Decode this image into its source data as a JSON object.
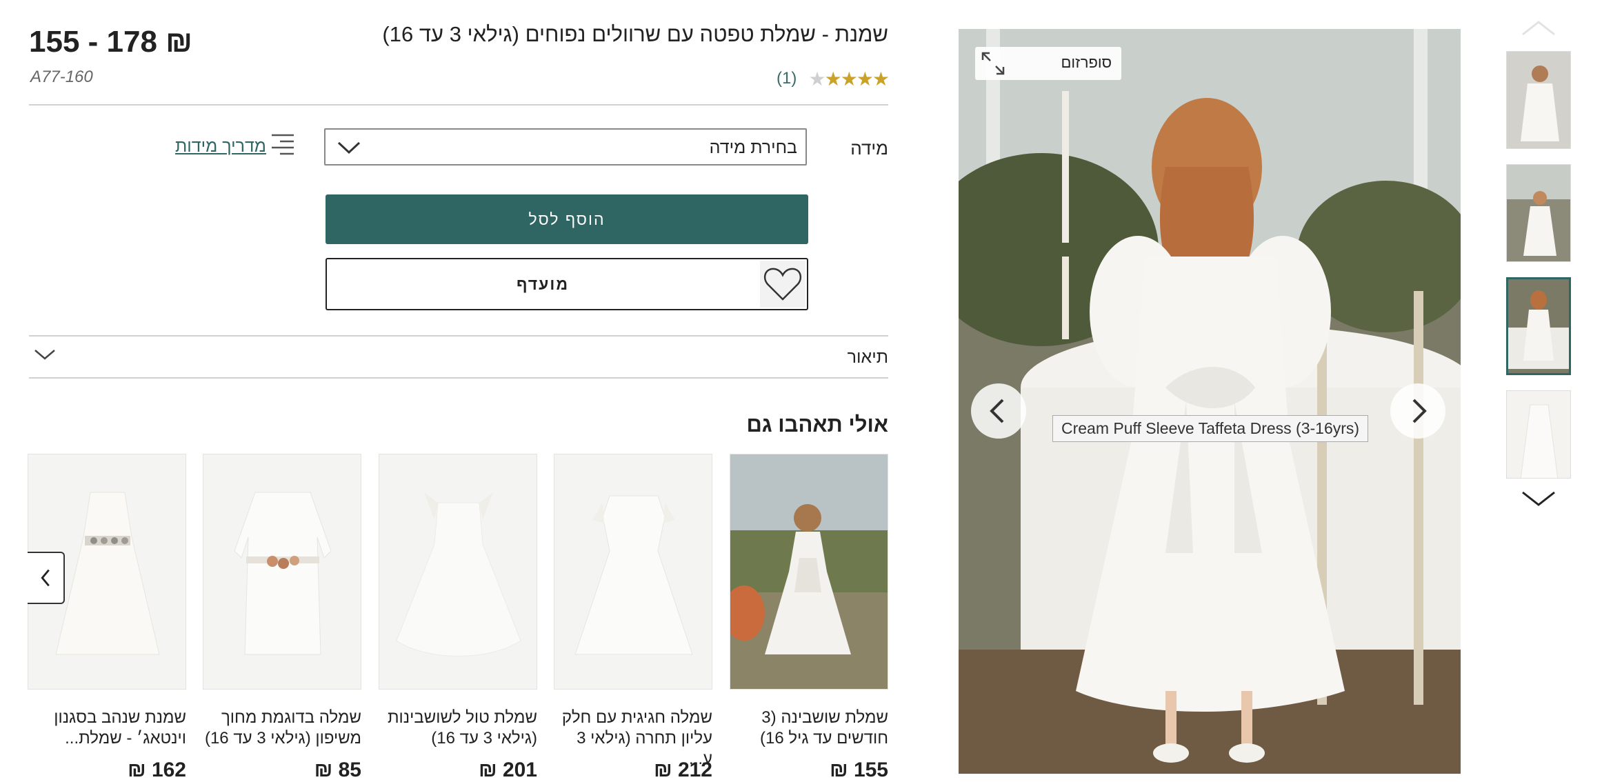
{
  "product": {
    "title": "שמנת - שמלת טפטה עם שרוולים נפוחים (גילאי 3 עד 16)",
    "price": "155 - 178 ₪",
    "code": "A77-160",
    "rating": 4,
    "rating_max": 5,
    "review_count": "(1)"
  },
  "options": {
    "size_label": "מידה",
    "size_select_value": "בחירת מידה",
    "size_guide_label": "מדריך מידות"
  },
  "actions": {
    "add_to_bag": "הוסף לסל",
    "favourite": "מועדף"
  },
  "description": {
    "label": "תיאור"
  },
  "recommendations": {
    "title": "אולי תאהבו גם",
    "items": [
      {
        "name": "שמלת שושבינה (3 חודשים עד גיל 16)",
        "price": "155 ₪"
      },
      {
        "name": "שמלה חגיגית עם חלק עליון תחרה (גילאי 3 ע...",
        "price": "212 ₪"
      },
      {
        "name": "שמלת טול לשושבינות (גילאי 3 עד 16)",
        "price": "201 ₪"
      },
      {
        "name": "שמלה בדוגמת מחוך משיפון (גילאי 3 עד 16)",
        "price": "85 ₪"
      },
      {
        "name": "שמנת שנהב בסגנון וינטאג׳ - שמלת...",
        "price": "162 ₪"
      }
    ]
  },
  "gallery": {
    "zoom_label": "סופרזום",
    "image_tooltip": "Cream Puff Sleeve Taffeta Dress (3-16yrs)",
    "active_thumb": 3
  },
  "colors": {
    "accent": "#2f6562",
    "star": "#c9a227"
  }
}
